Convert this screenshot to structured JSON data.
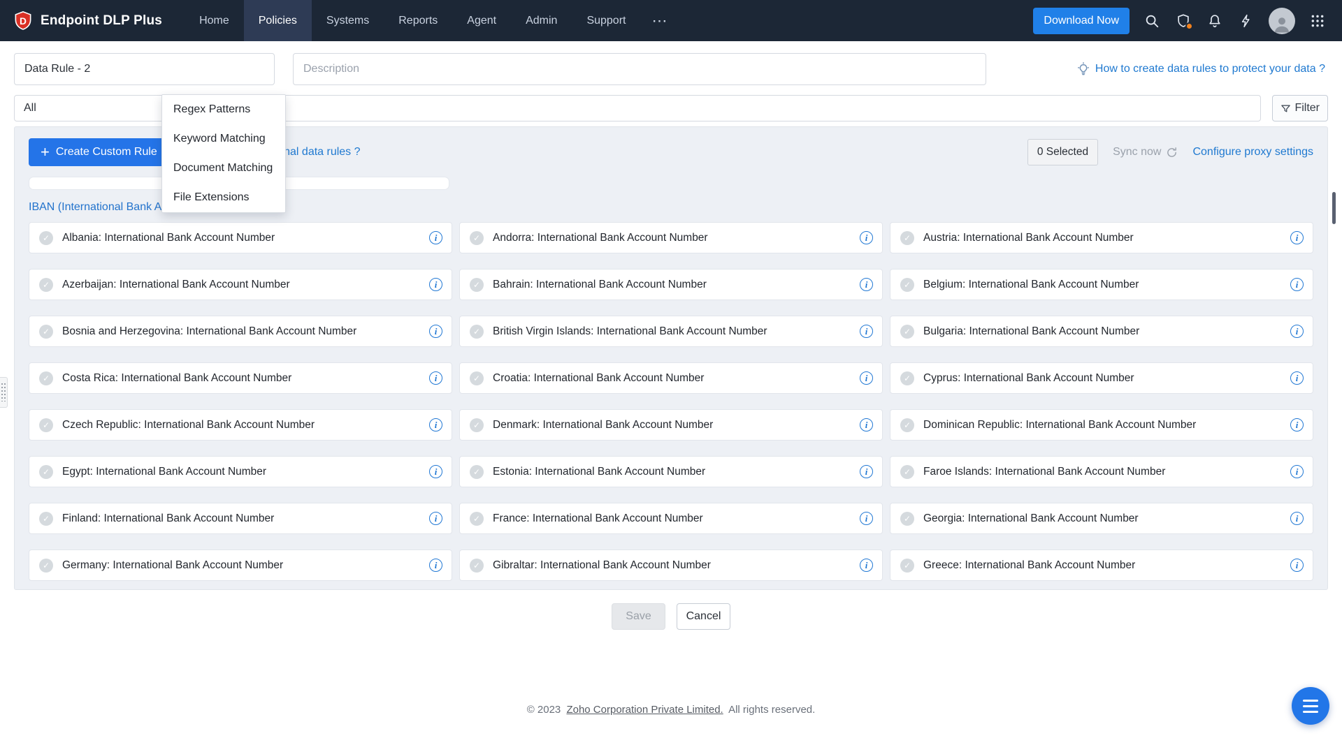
{
  "navbar": {
    "brand": "Endpoint DLP Plus",
    "items": [
      "Home",
      "Policies",
      "Systems",
      "Reports",
      "Agent",
      "Admin",
      "Support"
    ],
    "active": "Policies",
    "download_label": "Download Now"
  },
  "form": {
    "rule_name_value": "Data Rule - 2",
    "description_placeholder": "Description",
    "help_link": "How to create data rules to protect your data ?",
    "scope_value": "All",
    "filter_label": "Filter"
  },
  "type_menu": {
    "items": [
      "Regex Patterns",
      "Keyword Matching",
      "Document Matching",
      "File Extensions"
    ]
  },
  "toolbar": {
    "create_button": "Create Custom Rule",
    "additional_help_link": "How to create additional data rules ?",
    "selected_count": "0 Selected",
    "sync_label": "Sync now",
    "proxy_link": "Configure proxy settings"
  },
  "section_title": "IBAN (International Bank Account Number)",
  "rules": [
    "Albania: International Bank Account Number",
    "Andorra: International Bank Account Number",
    "Austria: International Bank Account Number",
    "Azerbaijan: International Bank Account Number",
    "Bahrain: International Bank Account Number",
    "Belgium: International Bank Account Number",
    "Bosnia and Herzegovina: International Bank Account Number",
    "British Virgin Islands: International Bank Account Number",
    "Bulgaria: International Bank Account Number",
    "Costa Rica: International Bank Account Number",
    "Croatia: International Bank Account Number",
    "Cyprus: International Bank Account Number",
    "Czech Republic: International Bank Account Number",
    "Denmark: International Bank Account Number",
    "Dominican Republic: International Bank Account Number",
    "Egypt: International Bank Account Number",
    "Estonia: International Bank Account Number",
    "Faroe Islands: International Bank Account Number",
    "Finland: International Bank Account Number",
    "France: International Bank Account Number",
    "Georgia: International Bank Account Number",
    "Germany: International Bank Account Number",
    "Gibraltar: International Bank Account Number",
    "Greece: International Bank Account Number"
  ],
  "actions": {
    "save": "Save",
    "cancel": "Cancel"
  },
  "footer": {
    "prefix": "© 2023",
    "company_link": "Zoho Corporation Private Limited.",
    "suffix": "All rights reserved."
  }
}
